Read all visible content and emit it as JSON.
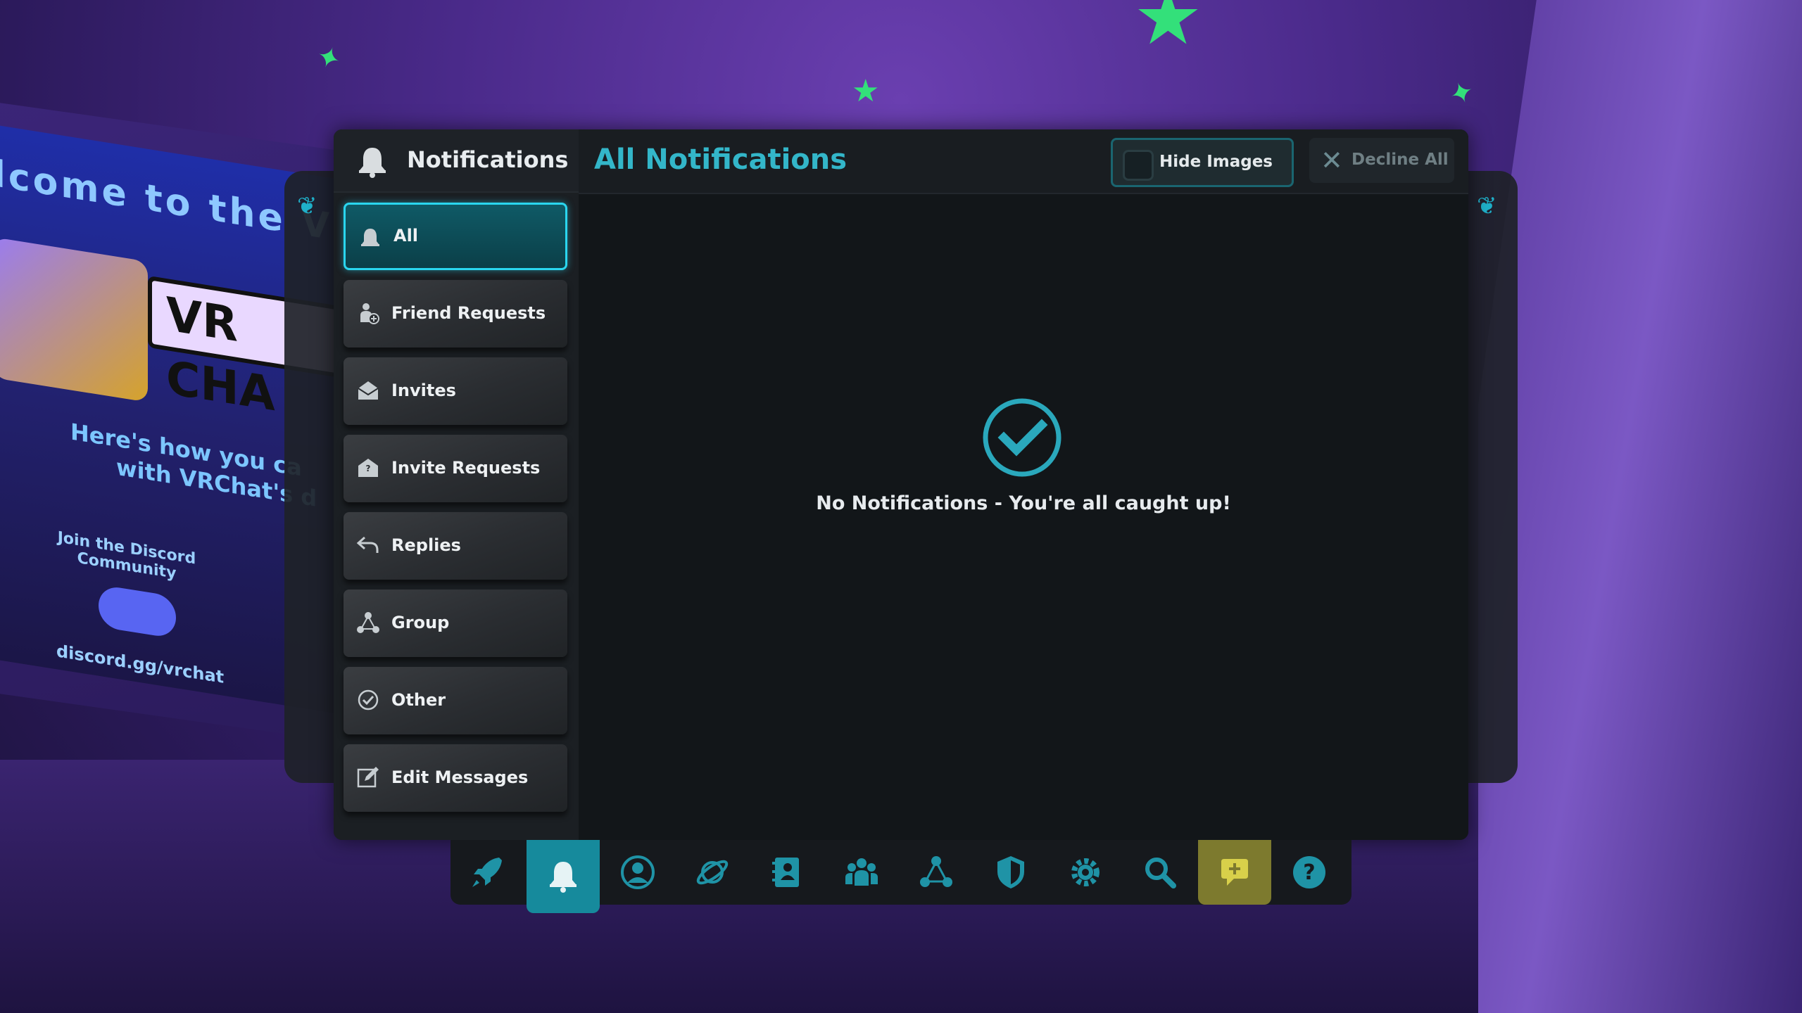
{
  "background": {
    "poster_line1": "lcome to the VRCh",
    "poster_logo": "VR CHA",
    "poster_line2": "Here's how you ca",
    "poster_line3": "with VRChat's d",
    "poster_join": "Join the Discord Community",
    "poster_url": "discord.gg/vrchat"
  },
  "sidebar": {
    "title": "Notifications",
    "title_icon": "bell-icon",
    "items": [
      {
        "label": "All",
        "icon": "bell-icon",
        "active": true
      },
      {
        "label": "Friend Requests",
        "icon": "friend-add-icon"
      },
      {
        "label": "Invites",
        "icon": "envelope-open-icon"
      },
      {
        "label": "Invite Requests",
        "icon": "envelope-question-icon"
      },
      {
        "label": "Replies",
        "icon": "reply-icon"
      },
      {
        "label": "Group",
        "icon": "group-nodes-icon"
      },
      {
        "label": "Other",
        "icon": "check-circle-icon"
      },
      {
        "label": "Edit Messages",
        "icon": "edit-icon"
      }
    ]
  },
  "content": {
    "title": "All Notifications",
    "hide_images_label": "Hide Images",
    "decline_all_label": "Decline All",
    "empty_message": "No Notifications - You're all caught up!",
    "empty_icon": "check-circle-icon"
  },
  "dock": {
    "items": [
      {
        "icon": "rocket-icon"
      },
      {
        "icon": "bell-icon",
        "active": true
      },
      {
        "icon": "profile-icon"
      },
      {
        "icon": "planet-icon"
      },
      {
        "icon": "avatar-book-icon"
      },
      {
        "icon": "friends-icon"
      },
      {
        "icon": "group-nodes-icon"
      },
      {
        "icon": "shield-icon"
      },
      {
        "icon": "gear-icon"
      },
      {
        "icon": "search-icon"
      },
      {
        "icon": "chat-plus-icon",
        "highlight": true
      },
      {
        "icon": "help-icon"
      }
    ]
  },
  "colors": {
    "accent": "#2ad6ef",
    "title_teal": "#33b6c9",
    "panel": "#16191d",
    "dock_highlight": "#7d7a2e"
  }
}
